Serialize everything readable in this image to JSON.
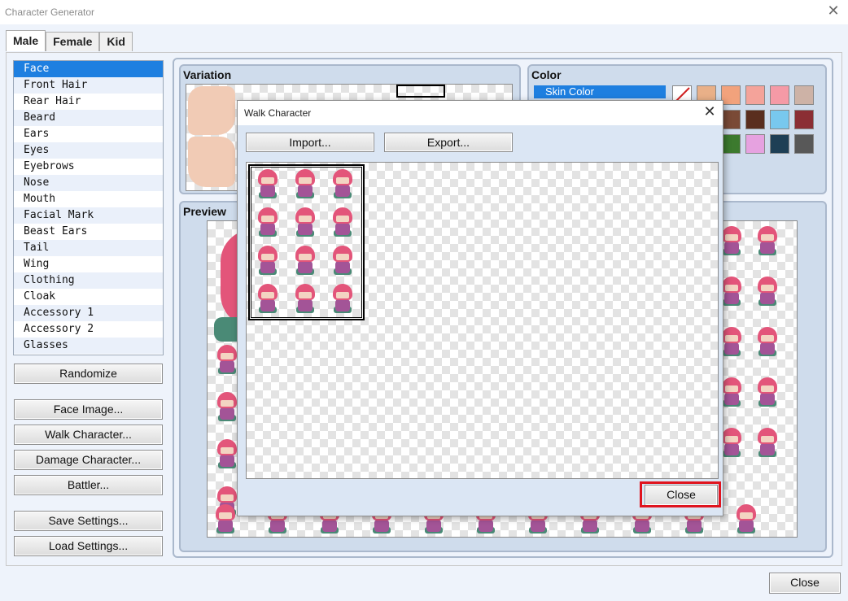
{
  "app": {
    "title": "Character Generator",
    "close_glyph": "✕"
  },
  "tabs": [
    {
      "label": "Male",
      "active": true
    },
    {
      "label": "Female",
      "active": false
    },
    {
      "label": "Kid",
      "active": false
    }
  ],
  "parts": {
    "items": [
      "Face",
      "Front Hair",
      "Rear Hair",
      "Beard",
      "Ears",
      "Eyes",
      "Eyebrows",
      "Nose",
      "Mouth",
      "Facial Mark",
      "Beast Ears",
      "Tail",
      "Wing",
      "Clothing",
      "Cloak",
      "Accessory 1",
      "Accessory 2",
      "Glasses"
    ],
    "selected": "Face"
  },
  "buttons": {
    "randomize": "Randomize",
    "face_image": "Face Image...",
    "walk_character": "Walk Character...",
    "damage_character": "Damage Character...",
    "battler": "Battler...",
    "save_settings": "Save Settings...",
    "load_settings": "Load Settings...",
    "close": "Close"
  },
  "variation": {
    "title": "Variation"
  },
  "color": {
    "title": "Color",
    "selected_label": "Skin Color",
    "swatches": [
      "#e9b088",
      "#f2a27c",
      "#f4a39a",
      "#f59aa6",
      "#cdb2a6",
      "#7a4a36",
      "#5a2e1e",
      "#78c8ee",
      "#8b2e34",
      "#3c7a2e",
      "#e6a2e0",
      "#1e3f55",
      "#585858"
    ]
  },
  "preview": {
    "title": "Preview"
  },
  "walk_dialog": {
    "title": "Walk Character",
    "import_label": "Import...",
    "export_label": "Export...",
    "close_label": "Close"
  },
  "colors": {
    "selection": "#1e7fe0",
    "panel": "#cfdcec",
    "hair": "#e3557a",
    "highlight": "#e0141e"
  }
}
